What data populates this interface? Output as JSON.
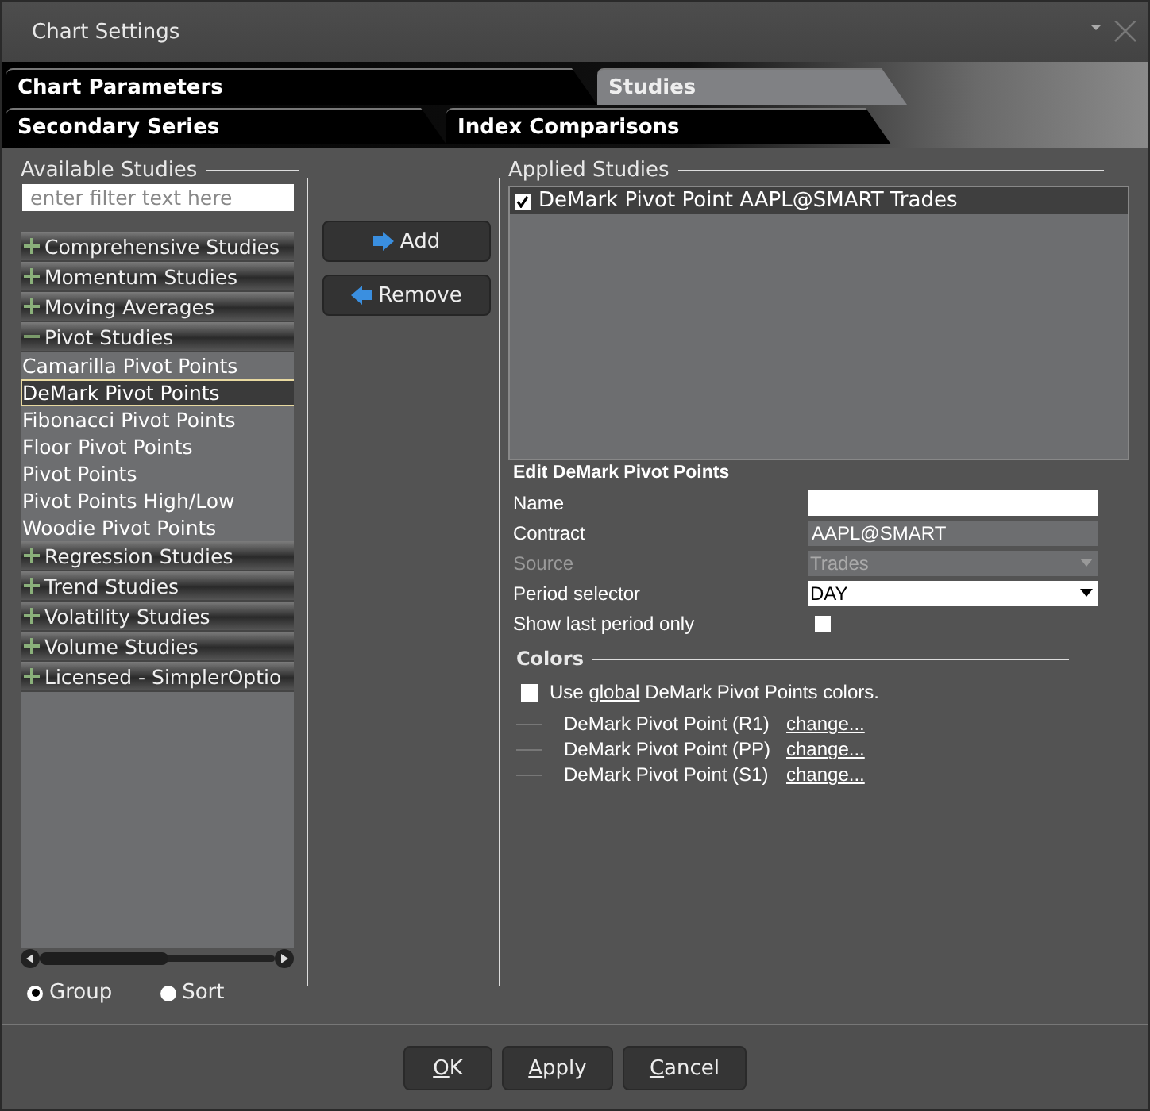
{
  "window": {
    "title": "Chart Settings"
  },
  "tab_rows": [
    [
      {
        "label": "Chart Parameters",
        "selected": false
      },
      {
        "label": "Studies",
        "selected": true
      }
    ],
    [
      {
        "label": "Secondary Series",
        "selected": false
      },
      {
        "label": "Index Comparisons",
        "selected": false
      }
    ]
  ],
  "available_studies": {
    "title": "Available Studies",
    "filter": {
      "placeholder": "enter filter text here"
    },
    "groups": [
      {
        "label": "Comprehensive Studies",
        "expanded": false
      },
      {
        "label": "Momentum Studies",
        "expanded": false
      },
      {
        "label": "Moving Averages",
        "expanded": false
      },
      {
        "label": "Pivot Studies",
        "expanded": true,
        "children": [
          {
            "label": "Camarilla Pivot Points",
            "selected": false
          },
          {
            "label": "DeMark Pivot Points",
            "selected": true
          },
          {
            "label": "Fibonacci Pivot Points",
            "selected": false
          },
          {
            "label": "Floor Pivot Points",
            "selected": false
          },
          {
            "label": "Pivot Points",
            "selected": false
          },
          {
            "label": "Pivot Points High/Low",
            "selected": false
          },
          {
            "label": "Woodie Pivot Points",
            "selected": false
          }
        ]
      },
      {
        "label": "Regression Studies",
        "expanded": false
      },
      {
        "label": "Trend Studies",
        "expanded": false
      },
      {
        "label": "Volatility Studies",
        "expanded": false
      },
      {
        "label": "Volume Studies",
        "expanded": false
      },
      {
        "label": "Licensed - SimplerOptio",
        "expanded": false
      }
    ],
    "view_options": [
      {
        "label": "Group",
        "selected": true
      },
      {
        "label": "Sort",
        "selected": false
      }
    ]
  },
  "actions": [
    {
      "label": "Add",
      "kind": "add"
    },
    {
      "label": "Remove",
      "kind": "remove"
    }
  ],
  "applied_studies": {
    "title": "Applied Studies",
    "items": [
      {
        "label": "DeMark Pivot Point AAPL@SMART Trades",
        "checked": true,
        "selected": true
      }
    ]
  },
  "edit": {
    "title": "Edit DeMark Pivot Points",
    "fields": [
      {
        "label": "Name",
        "kind": "text",
        "disabled": false
      },
      {
        "label": "Contract",
        "kind": "readonly",
        "value": "AAPL@SMART",
        "disabled": false
      },
      {
        "label": "Source",
        "kind": "dropdown",
        "value": "Trades",
        "disabled": true
      },
      {
        "label": "Period selector",
        "kind": "dropdown",
        "value": "DAY",
        "disabled": false
      },
      {
        "label": "Show last period only",
        "kind": "checkbox",
        "checked": false,
        "disabled": false
      }
    ]
  },
  "colors": {
    "title": "Colors",
    "use_global": {
      "checked": false,
      "before": "Use",
      "link": "global",
      "after": "DeMark Pivot Points colors."
    },
    "lines": [
      {
        "label": "DeMark Pivot Point (R1)",
        "link": "change..."
      },
      {
        "label": "DeMark Pivot Point (PP)",
        "link": "change..."
      },
      {
        "label": "DeMark Pivot Point (S1)",
        "link": "change..."
      }
    ]
  },
  "buttons": [
    "OK",
    "Apply",
    "Cancel"
  ]
}
